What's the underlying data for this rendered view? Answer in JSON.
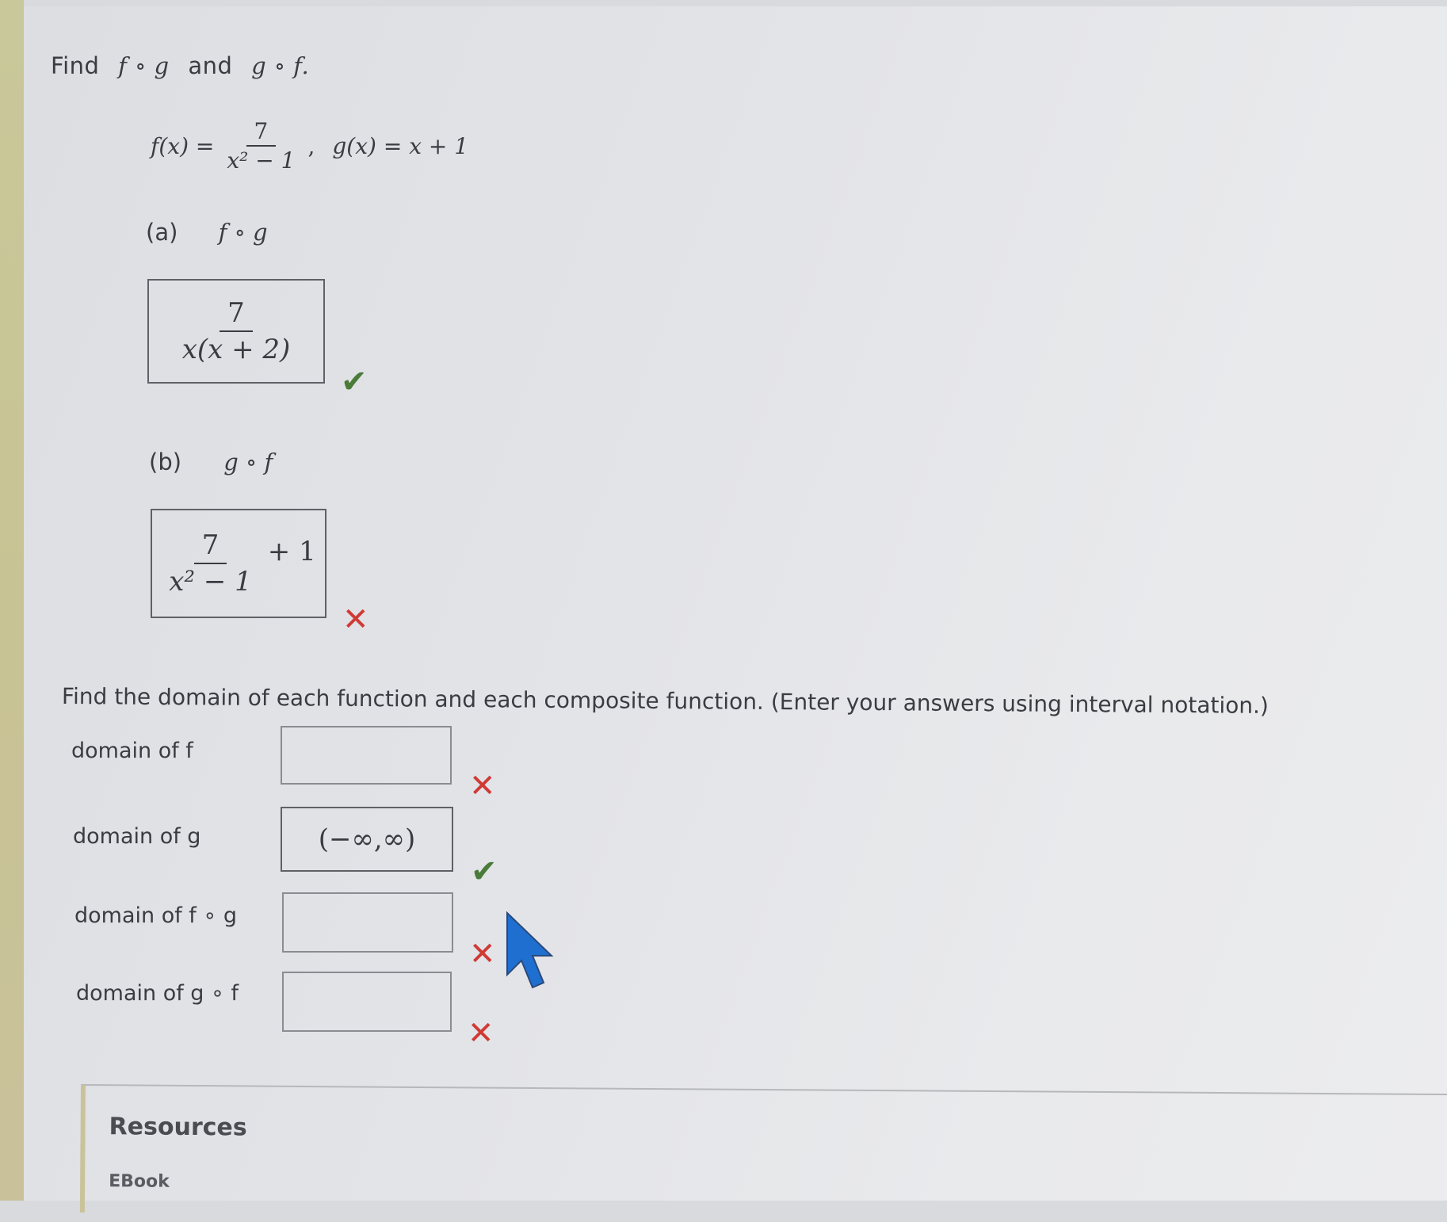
{
  "question": {
    "prompt_find": "Find",
    "fg": "f ∘ g",
    "and": "and",
    "gf": "g ∘ f.",
    "f_lhs": "f(x) =",
    "f_num": "7",
    "f_den": "x² − 1",
    "sep": ",",
    "g_def": "g(x) = x + 1"
  },
  "part_a": {
    "label": "(a)",
    "expr": "f ∘ g",
    "answer_num": "7",
    "answer_den": "x(x + 2)",
    "status": "correct"
  },
  "part_b": {
    "label": "(b)",
    "expr": "g ∘ f",
    "answer_num": "7",
    "answer_den": "x² − 1",
    "answer_tail": "+ 1",
    "status": "incorrect"
  },
  "domain_section": {
    "instructions": "Find the domain of each function and each composite function. (Enter your answers using interval notation.)",
    "rows": [
      {
        "label": "domain of f",
        "value": "",
        "status": "incorrect"
      },
      {
        "label": "domain of g",
        "value": "(−∞,∞)",
        "status": "correct"
      },
      {
        "label": "domain of f ∘ g",
        "value": "",
        "status": "incorrect"
      },
      {
        "label": "domain of g ∘ f",
        "value": "",
        "status": "incorrect"
      }
    ]
  },
  "marks": {
    "correct": "✔",
    "incorrect": "✕"
  },
  "resources": {
    "title": "Resources",
    "ebook": "EBook"
  },
  "colors": {
    "correct": "#4a7b39",
    "incorrect": "#d03a34",
    "cursor": "#1f6fd1"
  },
  "icons": [
    "checkmark-icon",
    "x-mark-icon",
    "mouse-cursor-icon"
  ]
}
